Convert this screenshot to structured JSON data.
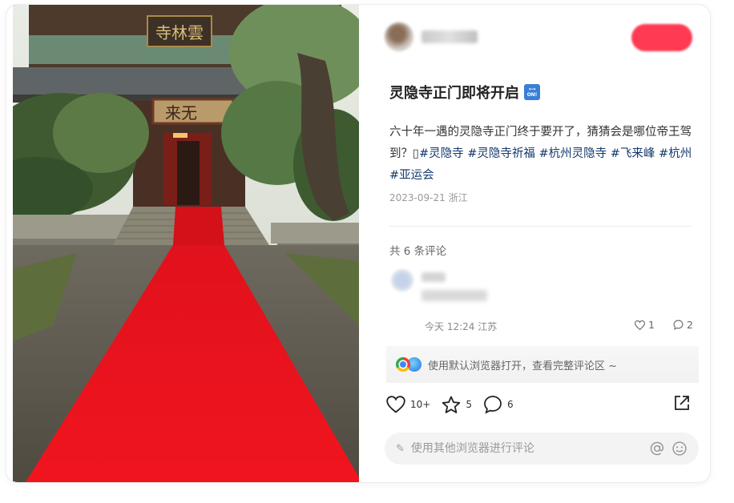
{
  "post": {
    "title": "灵隐寺正门即将开启",
    "badge": "ON!",
    "body_prefix": "六十年一遇的灵隐寺正门终于要开了，猜猜会是哪位帝王驾到？",
    "body_glyph": "▯",
    "tags": [
      "#灵隐寺",
      "#灵隐寺祈福",
      "#杭州灵隐寺",
      "#飞来峰",
      "#杭州",
      "#亚运会"
    ],
    "date": "2023-09-21",
    "location": "浙江"
  },
  "comments": {
    "count_label": "共 6 条评论",
    "items": [
      {
        "time": "今天 12:24",
        "location": "江苏",
        "likes": "1",
        "replies": "2"
      }
    ]
  },
  "open_browser": {
    "label": "使用默认浏览器打开，查看完整评论区 ~"
  },
  "actions": {
    "likes": "10+",
    "stars": "5",
    "comments": "6"
  },
  "comment_input": {
    "placeholder": "使用其他浏览器进行评论"
  },
  "photo": {
    "plaque_top": "寺林雲",
    "plaque_gate": "来无"
  },
  "colors": {
    "accent": "#ff3a52",
    "tag": "#13386c",
    "carpet": "#e8141c"
  }
}
